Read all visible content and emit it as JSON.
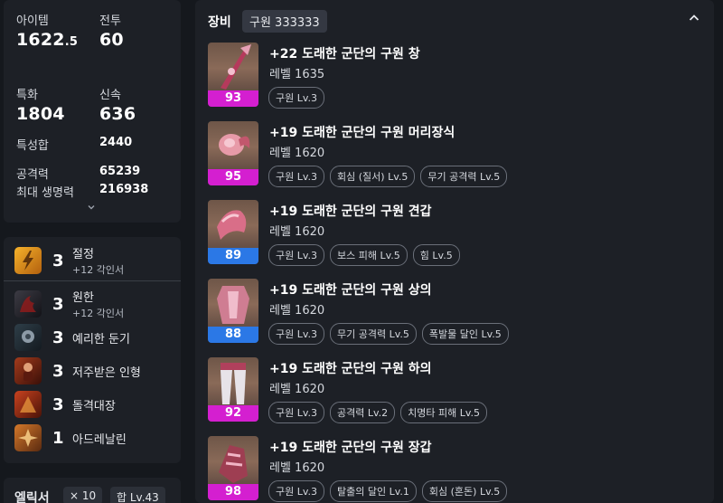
{
  "stats": {
    "item_level_label": "아이템",
    "item_level_main": "1622",
    "item_level_dec": ".5",
    "combat_label": "전투",
    "combat_value": "60",
    "crit_label": "특화",
    "crit_value": "1804",
    "swift_label": "신속",
    "swift_value": "636",
    "trait_sum_label": "특성합",
    "trait_sum_value": "2440",
    "attack_label": "공격력",
    "attack_value": "65239",
    "hp_label": "최대 생명력",
    "hp_value": "216938",
    "expand_icon": "chevron-down-icon"
  },
  "engravings": [
    {
      "level": "3",
      "name": "절정",
      "sub": "+12 각인서",
      "icon": "lightning-icon"
    },
    {
      "level": "3",
      "name": "원한",
      "sub": "+12 각인서",
      "icon": "demon-icon"
    },
    {
      "level": "3",
      "name": "예리한 둔기",
      "sub": "",
      "icon": "mace-icon"
    },
    {
      "level": "3",
      "name": "저주받은 인형",
      "sub": "",
      "icon": "doll-icon"
    },
    {
      "level": "3",
      "name": "돌격대장",
      "sub": "",
      "icon": "charge-icon"
    },
    {
      "level": "1",
      "name": "아드레날린",
      "sub": "",
      "icon": "adrenaline-icon"
    }
  ],
  "elixir": {
    "title": "엘릭서",
    "count": "× 10",
    "total": "합 Lv.43"
  },
  "equipment": {
    "title": "장비",
    "set_badge": "구원 333333",
    "collapse_icon": "chevron-up-icon",
    "items": [
      {
        "name": "+22 도래한 군단의 구원 창",
        "level": "레벨 1635",
        "quality": "93",
        "quality_color": "#d41fd0",
        "tags": [
          "구원 Lv.3"
        ],
        "icon": "spear-icon"
      },
      {
        "name": "+19 도래한 군단의 구원 머리장식",
        "level": "레벨 1620",
        "quality": "95",
        "quality_color": "#d41fd0",
        "tags": [
          "구원 Lv.3",
          "회심 (질서) Lv.5",
          "무기 공격력 Lv.5"
        ],
        "icon": "helmet-icon"
      },
      {
        "name": "+19 도래한 군단의 구원 견갑",
        "level": "레벨 1620",
        "quality": "89",
        "quality_color": "#2b78e6",
        "tags": [
          "구원 Lv.3",
          "보스 피해 Lv.5",
          "힘 Lv.5"
        ],
        "icon": "shoulder-icon"
      },
      {
        "name": "+19 도래한 군단의 구원 상의",
        "level": "레벨 1620",
        "quality": "88",
        "quality_color": "#2b78e6",
        "tags": [
          "구원 Lv.3",
          "무기 공격력 Lv.5",
          "폭발물 달인 Lv.5"
        ],
        "icon": "chest-armor-icon"
      },
      {
        "name": "+19 도래한 군단의 구원 하의",
        "level": "레벨 1620",
        "quality": "92",
        "quality_color": "#d41fd0",
        "tags": [
          "구원 Lv.3",
          "공격력 Lv.2",
          "치명타 피해 Lv.5"
        ],
        "icon": "pants-icon"
      },
      {
        "name": "+19 도래한 군단의 구원 장갑",
        "level": "레벨 1620",
        "quality": "98",
        "quality_color": "#d41fd0",
        "tags": [
          "구원 Lv.3",
          "탈출의 달인 Lv.1",
          "회심 (혼돈) Lv.5"
        ],
        "icon": "gloves-icon"
      }
    ]
  }
}
